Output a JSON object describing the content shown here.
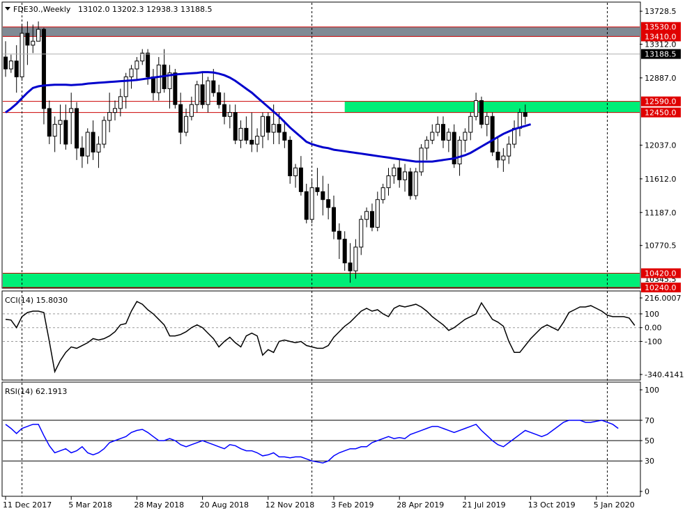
{
  "header": {
    "symbol": "FDE30.,Weekly",
    "ohlc": "13102.0 13202.3 12938.3 13188.5"
  },
  "chart_data": {
    "type": "candlestick",
    "colors": {
      "background": "#ffffff",
      "up_candle": "#ffffff",
      "down_candle": "#000000",
      "moving_average": "#0000cc",
      "resistance_zone": "#808a94",
      "support_zone": "#00ee77",
      "zone_border": "#cc0000",
      "label_bg": "#e00000",
      "current_price_bg": "#000000",
      "rsi_line": "#0000ff",
      "cci_line": "#000000"
    },
    "price_axis": {
      "ylim": [
        10240,
        13800
      ],
      "ticks": [
        "13728.5",
        "13312.0",
        "12887.0",
        "12037.0",
        "11612.0",
        "11187.0",
        "10770.5"
      ]
    },
    "x_axis": {
      "ticks": [
        "11 Dec 2017",
        "5 Mar 2018",
        "28 May 2018",
        "20 Aug 2018",
        "12 Nov 2018",
        "3 Feb 2019",
        "28 Apr 2019",
        "21 Jul 2019",
        "13 Oct 2019",
        "5 Jan 2020"
      ],
      "tick_index": [
        0,
        12,
        24,
        36,
        48,
        60,
        72,
        84,
        96,
        108
      ]
    },
    "vertical_markers_index": [
      3,
      56,
      110
    ],
    "zones": [
      {
        "name": "resistance",
        "low": 13410.0,
        "high": 13530.0,
        "label_low": "13410.0",
        "label_high": "13530.0",
        "start_index": 0
      },
      {
        "name": "mid",
        "low": 12450.0,
        "high": 12590.0,
        "label_low": "12450.0",
        "label_high": "12590.0",
        "start_index": 62
      },
      {
        "name": "support",
        "low": 10240.0,
        "high": 10420.0,
        "label_low": "10240.0",
        "label_high": "10420.0",
        "start_index": 0
      }
    ],
    "hidden_tick": "10345.5",
    "current_price": {
      "value": 13188.5,
      "label": "13188.5"
    },
    "candles": [
      [
        13150,
        13350,
        12900,
        13000
      ],
      [
        13000,
        13180,
        12950,
        13100
      ],
      [
        13100,
        13300,
        12700,
        12900
      ],
      [
        12900,
        13550,
        12850,
        13450
      ],
      [
        13450,
        13600,
        13050,
        13300
      ],
      [
        13300,
        13560,
        13200,
        13350
      ],
      [
        13350,
        13600,
        13350,
        13500
      ],
      [
        13500,
        13520,
        12300,
        12500
      ],
      [
        12500,
        12600,
        12050,
        12150
      ],
      [
        12150,
        12400,
        11950,
        12300
      ],
      [
        12300,
        12550,
        12050,
        12350
      ],
      [
        12350,
        12550,
        11980,
        12050
      ],
      [
        12450,
        12700,
        12050,
        12500
      ],
      [
        12500,
        12580,
        11850,
        12000
      ],
      [
        12000,
        12150,
        11750,
        11900
      ],
      [
        11900,
        12250,
        11800,
        12200
      ],
      [
        12200,
        12350,
        11850,
        11950
      ],
      [
        11950,
        12150,
        11750,
        12050
      ],
      [
        12050,
        12400,
        12000,
        12350
      ],
      [
        12350,
        12700,
        12200,
        12450
      ],
      [
        12450,
        12600,
        12350,
        12500
      ],
      [
        12500,
        12750,
        12400,
        12650
      ],
      [
        12650,
        12950,
        12500,
        12900
      ],
      [
        12900,
        13050,
        12750,
        13000
      ],
      [
        13000,
        13150,
        12850,
        13100
      ],
      [
        13100,
        13250,
        13050,
        13200
      ],
      [
        13200,
        13250,
        12800,
        12900
      ],
      [
        12900,
        13000,
        12600,
        12700
      ],
      [
        12700,
        13150,
        12600,
        13050
      ],
      [
        13050,
        13250,
        12700,
        12750
      ],
      [
        12750,
        13050,
        12500,
        12950
      ],
      [
        12950,
        13000,
        12500,
        12550
      ],
      [
        12550,
        12700,
        12050,
        12200
      ],
      [
        12200,
        12500,
        12150,
        12400
      ],
      [
        12400,
        12650,
        12350,
        12550
      ],
      [
        12550,
        12850,
        12450,
        12800
      ],
      [
        12800,
        12950,
        12500,
        12550
      ],
      [
        12550,
        12900,
        12450,
        12850
      ],
      [
        12850,
        13000,
        12650,
        12700
      ],
      [
        12700,
        12800,
        12500,
        12550
      ],
      [
        12550,
        12700,
        12300,
        12400
      ],
      [
        12400,
        12550,
        12250,
        12450
      ],
      [
        12450,
        12550,
        12050,
        12100
      ],
      [
        12100,
        12350,
        12000,
        12250
      ],
      [
        12250,
        12400,
        12050,
        12100
      ],
      [
        12100,
        12450,
        11950,
        12050
      ],
      [
        12050,
        12250,
        11950,
        12150
      ],
      [
        12150,
        12450,
        12000,
        12400
      ],
      [
        12400,
        12450,
        12100,
        12200
      ],
      [
        12200,
        12550,
        12050,
        12300
      ],
      [
        12300,
        12450,
        12050,
        12200
      ],
      [
        12200,
        12350,
        12000,
        12100
      ],
      [
        12100,
        12150,
        11550,
        11650
      ],
      [
        11650,
        11800,
        11500,
        11750
      ],
      [
        11750,
        11900,
        11400,
        11450
      ],
      [
        11450,
        11550,
        11050,
        11100
      ],
      [
        11100,
        11600,
        11050,
        11500
      ],
      [
        11500,
        11750,
        11400,
        11450
      ],
      [
        11450,
        11650,
        11150,
        11350
      ],
      [
        11350,
        11550,
        11100,
        11250
      ],
      [
        11250,
        11400,
        10850,
        10950
      ],
      [
        10950,
        11050,
        10600,
        10850
      ],
      [
        10850,
        10950,
        10450,
        10550
      ],
      [
        10550,
        10800,
        10300,
        10450
      ],
      [
        10450,
        10850,
        10350,
        10750
      ],
      [
        10750,
        11150,
        10650,
        11100
      ],
      [
        11100,
        11250,
        11000,
        11200
      ],
      [
        11200,
        11300,
        10950,
        11000
      ],
      [
        11000,
        11450,
        10950,
        11350
      ],
      [
        11350,
        11550,
        11300,
        11500
      ],
      [
        11500,
        11750,
        11400,
        11650
      ],
      [
        11650,
        11800,
        11550,
        11750
      ],
      [
        11750,
        11850,
        11500,
        11600
      ],
      [
        11600,
        11800,
        11450,
        11700
      ],
      [
        11700,
        11750,
        11350,
        11400
      ],
      [
        11400,
        11750,
        11350,
        11700
      ],
      [
        11700,
        12050,
        11650,
        12000
      ],
      [
        12000,
        12150,
        11850,
        12100
      ],
      [
        12100,
        12300,
        12050,
        12200
      ],
      [
        12200,
        12400,
        12150,
        12300
      ],
      [
        12300,
        12400,
        12000,
        12100
      ],
      [
        12100,
        12250,
        11950,
        12200
      ],
      [
        12200,
        12300,
        11750,
        11800
      ],
      [
        11800,
        12150,
        11650,
        12100
      ],
      [
        12100,
        12250,
        11950,
        12200
      ],
      [
        12200,
        12450,
        12100,
        12400
      ],
      [
        12400,
        12700,
        12350,
        12600
      ],
      [
        12600,
        12650,
        12250,
        12300
      ],
      [
        12300,
        12450,
        12150,
        12400
      ],
      [
        12400,
        12450,
        11900,
        11950
      ],
      [
        11950,
        12150,
        11750,
        11850
      ],
      [
        11850,
        12000,
        11700,
        11900
      ],
      [
        11900,
        12150,
        11800,
        12050
      ],
      [
        12050,
        12350,
        12000,
        12250
      ],
      [
        12250,
        12500,
        12150,
        12450
      ],
      [
        12450,
        12550,
        12300,
        12400
      ]
    ],
    "ma": [
      12450,
      12500,
      12560,
      12630,
      12700,
      12760,
      12780,
      12790,
      12795,
      12800,
      12800,
      12800,
      12795,
      12800,
      12805,
      12815,
      12820,
      12825,
      12830,
      12835,
      12840,
      12845,
      12850,
      12855,
      12860,
      12870,
      12880,
      12890,
      12900,
      12910,
      12920,
      12930,
      12935,
      12940,
      12945,
      12950,
      12960,
      12960,
      12955,
      12940,
      12920,
      12890,
      12850,
      12800,
      12750,
      12700,
      12640,
      12580,
      12520,
      12460,
      12400,
      12330,
      12260,
      12200,
      12140,
      12080,
      12050,
      12030,
      12010,
      12000,
      11980,
      11970,
      11960,
      11950,
      11940,
      11930,
      11920,
      11910,
      11900,
      11890,
      11880,
      11870,
      11860,
      11850,
      11840,
      11830,
      11830,
      11830,
      11830,
      11840,
      11850,
      11860,
      11870,
      11890,
      11910,
      11940,
      11980,
      12020,
      12060,
      12100,
      12140,
      12180,
      12210,
      12240,
      12260,
      12280,
      12300
    ],
    "cci": {
      "label": "CCI(14) 15.8030",
      "ylim": [
        -340.4141,
        216.0007
      ],
      "ticks": [
        "216.0007",
        "100",
        "0.00",
        "-100",
        "-340.4141"
      ],
      "levels": [
        100,
        0,
        -100
      ],
      "values": [
        60,
        55,
        0,
        80,
        110,
        120,
        120,
        110,
        -100,
        -320,
        -240,
        -180,
        -140,
        -150,
        -130,
        -110,
        -80,
        -90,
        -80,
        -60,
        -30,
        20,
        30,
        120,
        190,
        170,
        130,
        100,
        60,
        20,
        -60,
        -60,
        -50,
        -30,
        0,
        20,
        0,
        -40,
        -80,
        -140,
        -100,
        -70,
        -110,
        -140,
        -60,
        -40,
        -60,
        -200,
        -160,
        -180,
        -100,
        -90,
        -100,
        -110,
        -100,
        -130,
        -140,
        -150,
        -150,
        -130,
        -70,
        -30,
        10,
        40,
        80,
        120,
        140,
        120,
        130,
        100,
        80,
        140,
        160,
        150,
        160,
        170,
        150,
        120,
        80,
        50,
        20,
        -20,
        0,
        30,
        60,
        80,
        100,
        180,
        120,
        60,
        40,
        10,
        -100,
        -180,
        -180,
        -130,
        -80,
        -40,
        0,
        20,
        0,
        -20,
        40,
        110,
        130,
        150,
        150,
        160,
        140,
        120,
        90,
        80,
        80,
        80,
        70,
        16
      ]
    },
    "rsi": {
      "label": "RSI(14) 62.1913",
      "ylim": [
        0,
        100
      ],
      "ticks": [
        "100",
        "70",
        "50",
        "30",
        "0"
      ],
      "levels": [
        70,
        50,
        30
      ],
      "values": [
        66,
        62,
        57,
        62,
        64,
        66,
        66,
        55,
        45,
        38,
        40,
        42,
        38,
        40,
        44,
        38,
        36,
        38,
        42,
        48,
        50,
        52,
        54,
        58,
        60,
        61,
        58,
        54,
        50,
        50,
        52,
        50,
        46,
        44,
        46,
        48,
        50,
        48,
        46,
        44,
        42,
        46,
        45,
        42,
        40,
        40,
        38,
        35,
        36,
        38,
        34,
        34,
        33,
        34,
        34,
        32,
        30,
        29,
        28,
        30,
        35,
        38,
        40,
        42,
        42,
        44,
        44,
        48,
        50,
        52,
        54,
        52,
        53,
        52,
        56,
        58,
        60,
        62,
        64,
        64,
        62,
        60,
        58,
        60,
        62,
        64,
        66,
        60,
        55,
        50,
        46,
        44,
        48,
        52,
        56,
        60,
        58,
        56,
        54,
        56,
        60,
        64,
        68,
        70,
        70,
        70,
        68,
        68,
        69,
        70,
        68,
        66,
        62
      ]
    }
  }
}
